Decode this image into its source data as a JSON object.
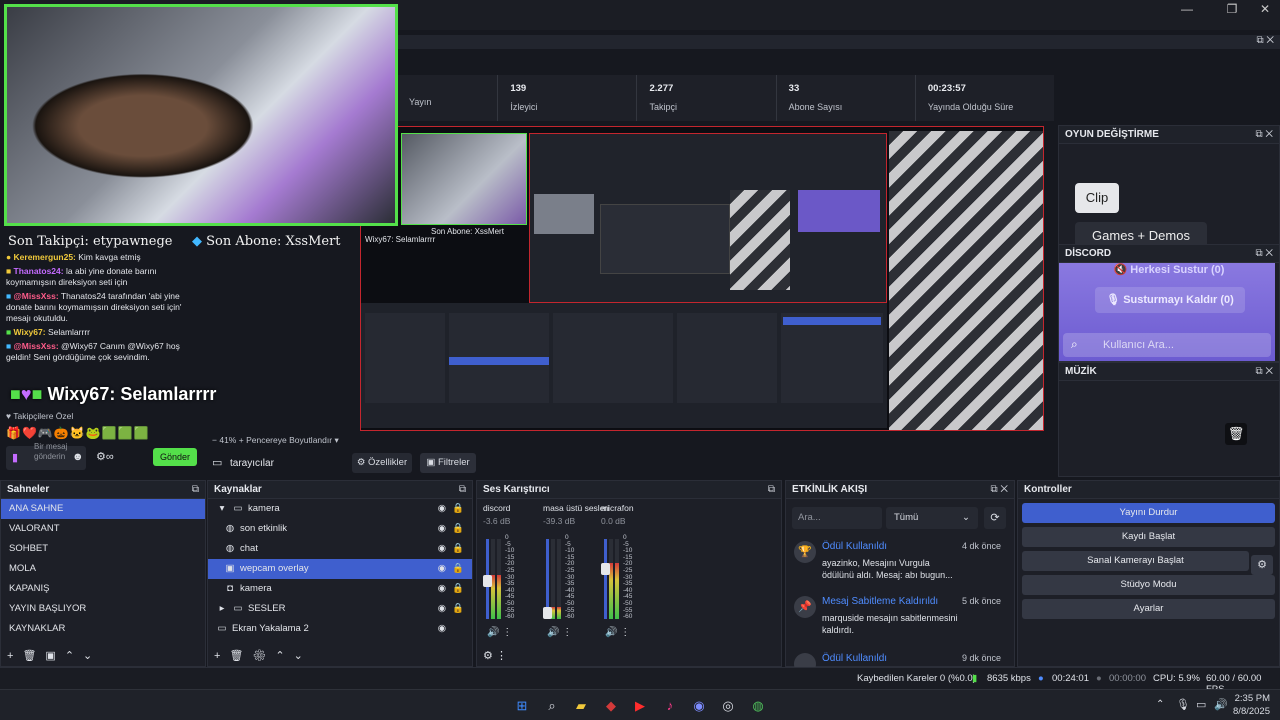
{
  "window": {
    "minimize": "—",
    "restore": "❐",
    "close": "✕"
  },
  "stats": [
    {
      "value": "",
      "label": "Yayın"
    },
    {
      "value": "139",
      "label": "İzleyici"
    },
    {
      "value": "2.277",
      "label": "Takipçi"
    },
    {
      "value": "33",
      "label": "Abone Sayısı"
    },
    {
      "value": "00:23:57",
      "label": "Yayında Olduğu Süre"
    }
  ],
  "overlay": {
    "last_follower": "Son Takipçi: etypawnege",
    "last_sub": "Son Abone: XssMert",
    "big_chat": "Wixy67: Selamlarrrr",
    "mini_chat": "Wixy67: Selamlarrrr",
    "mini_last_sub": "Son Abone: XssMert"
  },
  "chat": {
    "messages": [
      {
        "user": "Keremergun25:",
        "text": "Kim kavga etmiş",
        "color": "#f0c93b"
      },
      {
        "user": "Thanatos24:",
        "text": "la abi yine donate barını koymamışsın direksiyon seti için",
        "color": "#c46bff"
      },
      {
        "user": "@MissXss:",
        "text": "Thanatos24 tarafından 'abi yine donate barını koymamışsın direksiyon seti için' mesajı okutuldu.",
        "color": "#ff5c8a"
      },
      {
        "user": "Wixy67:",
        "text": "Selamlarrrr",
        "color": "#f0c93b"
      },
      {
        "user": "@MissXss:",
        "text": "@Wixy67 Canım @Wixy67 hoş geldin! Seni gördüğüme çok sevindim.",
        "color": "#ff5c8a"
      }
    ],
    "follower_only": "Takipçilere Özel",
    "input_placeholder": "Bir mesaj gönderin",
    "send_label": "Gönder"
  },
  "preview_bar": {
    "zoom": "41%",
    "fit_label": "Pencereye Boyutlandır"
  },
  "source_toolbar": {
    "source_name": "tarayıcılar",
    "properties": "Özellikler",
    "filters": "Filtreler"
  },
  "game_switch": {
    "title": "OYUN DEĞİŞTİRME",
    "clip": "Clip",
    "games": "Games + Demos"
  },
  "discord": {
    "title": "DİSCORD",
    "mute_all": "Herkesi Sustur (0)",
    "unmute": "Susturmayı Kaldır (0)",
    "search_placeholder": "Kullanıcı Ara..."
  },
  "music": {
    "title": "MÜZİK"
  },
  "scenes": {
    "title": "Sahneler",
    "items": [
      "ANA SAHNE",
      "VALORANT",
      "SOHBET",
      "MOLA",
      "KAPANIŞ",
      "YAYIN BAŞLIYOR",
      "KAYNAKLAR"
    ]
  },
  "sources": {
    "title": "Kaynaklar",
    "items": [
      {
        "label": "kamera",
        "icon": "folder-icon"
      },
      {
        "label": "son etkinlik",
        "icon": "globe-icon"
      },
      {
        "label": "chat",
        "icon": "globe-icon"
      },
      {
        "label": "wepcam overlay",
        "icon": "image-icon"
      },
      {
        "label": "kamera",
        "icon": "camera-icon"
      },
      {
        "label": "SESLER",
        "icon": "folder-icon"
      },
      {
        "label": "Ekran Yakalama 2",
        "icon": "monitor-icon"
      }
    ]
  },
  "mixer": {
    "title": "Ses Karıştırıcı",
    "channels": [
      {
        "name": "discord",
        "db": "-3.6 dB",
        "level": 0.55
      },
      {
        "name": "masa üstü sesleri",
        "db": "-39.3 dB",
        "level": 0.15
      },
      {
        "name": "micrafon",
        "db": "0.0 dB",
        "level": 0.7
      }
    ],
    "scale": [
      "0",
      "-5",
      "-10",
      "-15",
      "-20",
      "-25",
      "-30",
      "-35",
      "-40",
      "-45",
      "-50",
      "-55",
      "-60"
    ]
  },
  "activity": {
    "title": "ETKİNLİK AKIŞI",
    "search_placeholder": "Ara...",
    "filter": "Tümü",
    "items": [
      {
        "title": "Ödül Kullanıldı",
        "time": "4 dk önce",
        "desc": "ayazinko, Mesajını Vurgula ödülünü aldı. Mesaj: abı bugun..."
      },
      {
        "title": "Mesaj Sabitleme Kaldırıldı",
        "time": "5 dk önce",
        "desc": "marquside mesajın sabitlenmesini kaldırdı."
      },
      {
        "title": "Ödül Kullanıldı",
        "time": "9 dk önce",
        "desc": ""
      }
    ]
  },
  "controls": {
    "title": "Kontroller",
    "stop_stream": "Yayını Durdur",
    "start_record": "Kaydı Başlat",
    "start_vcam": "Sanal Kamerayı Başlat",
    "studio_mode": "Stüdyo Modu",
    "settings": "Ayarlar"
  },
  "status": {
    "dropped": "Kaybedilen Kareler 0 (%0.0)",
    "bitrate": "8635 kbps",
    "stream_time": "00:24:01",
    "rec_time": "00:00:00",
    "cpu": "CPU: 5.9%",
    "fps": "60.00 / 60.00 FPS"
  },
  "taskbar": {
    "time": "2:35 PM",
    "date": "8/8/2025"
  }
}
